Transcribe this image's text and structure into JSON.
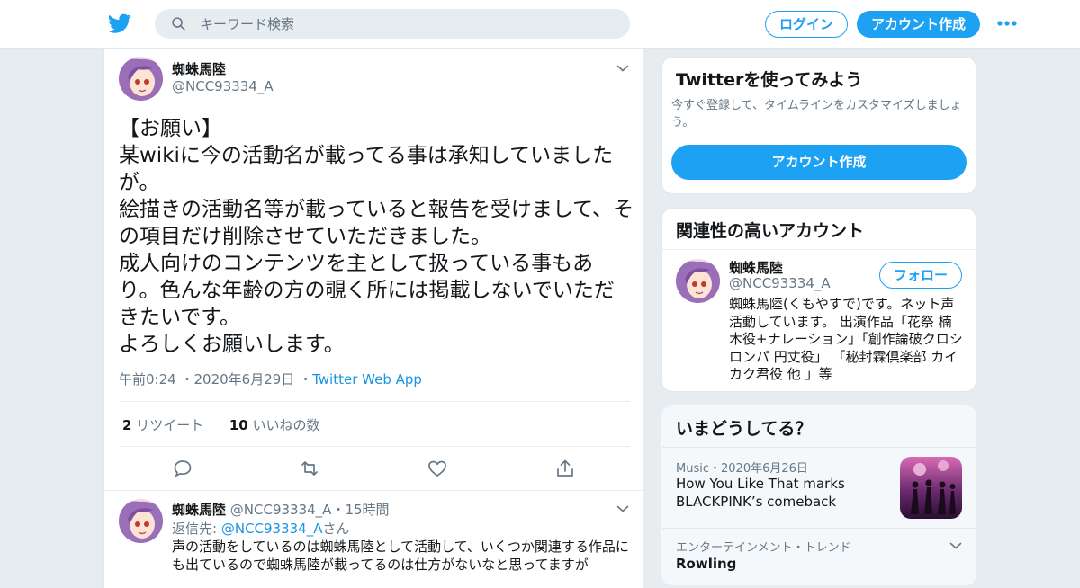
{
  "header": {
    "search_placeholder": "キーワード検索",
    "login_label": "ログイン",
    "signup_label": "アカウント作成"
  },
  "tweet": {
    "author_name": "蜘蛛馬陸",
    "author_handle": "@NCC93334_A",
    "text": "【お願い】\n某wikiに今の活動名が載ってる事は承知していましたが。\n絵描きの活動名等が載っていると報告を受けまして、その項目だけ削除させていただきました。\n成人向けのコンテンツを主として扱っている事もあり。色んな年齢の方の覗く所には掲載しないでいただきたいです。\nよろしくお願いします。",
    "time": "午前0:24",
    "date": "2020年6月29日",
    "source": "Twitter Web App",
    "retweet_count": "2",
    "retweet_label": "リツイート",
    "like_count": "10",
    "like_label": "いいねの数"
  },
  "reply": {
    "author_name": "蜘蛛馬陸",
    "author_handle": "@NCC93334_A",
    "age": "15時間",
    "reply_to_label": "返信先:",
    "reply_to_handle": "@NCC93334_A",
    "reply_to_suffix": "さん",
    "text": "声の活動をしているのは蜘蛛馬陸として活動して、いくつか関連する作品にも出ているので蜘蛛馬陸が載ってるのは仕方がないなと思ってますが"
  },
  "signup_card": {
    "title": "Twitterを使ってみよう",
    "text": "今すぐ登録して、タイムラインをカスタマイズしましょう。",
    "button_label": "アカウント作成"
  },
  "related_card": {
    "title": "関連性の高いアカウント",
    "name": "蜘蛛馬陸",
    "handle": "@NCC93334_A",
    "follow_label": "フォロー",
    "bio": "蜘蛛馬陸(くもやすで)です。ネット声活動しています。 出演作品「花祭 楠木役+ナレーション」「創作論破クロシロンパ 円丈役」 「秘封霖倶楽部 カイカク君役 他 」等"
  },
  "trends_card": {
    "title": "いまどうしてる？",
    "items": [
      {
        "category": "Music",
        "date": "2020年6月26日",
        "title": "How You Like That marks BLACKPINK’s comeback"
      },
      {
        "category": "エンターテインメント・トレンド",
        "title": "Rowling"
      }
    ]
  },
  "colors": {
    "brand": "#1da1f2",
    "link": "#1b95e0",
    "secondary_text": "#657786",
    "background": "#e6ecf0"
  },
  "icons": [
    "twitter-logo-icon",
    "search-icon",
    "more-icon",
    "chevron-down-icon",
    "reply-icon",
    "retweet-icon",
    "like-icon",
    "share-icon"
  ]
}
